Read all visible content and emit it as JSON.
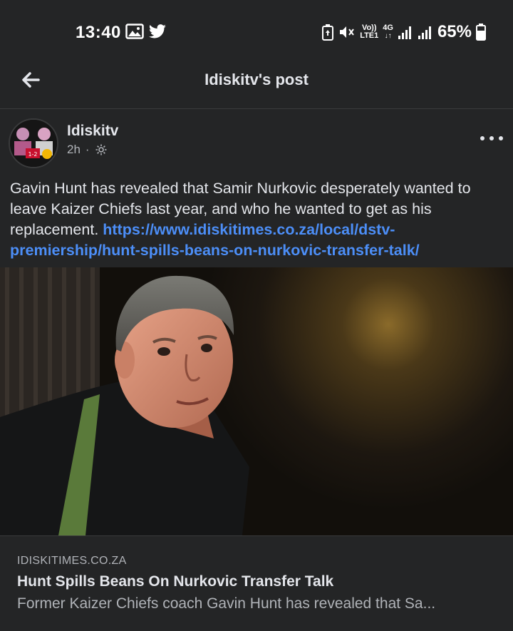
{
  "status_bar": {
    "time": "13:40",
    "left_icons": [
      "gallery-icon",
      "twitter-icon"
    ],
    "volte": "Vo))",
    "lte": "LTE1",
    "network": "4G",
    "battery": "65%"
  },
  "header": {
    "title": "Idiskitv's post",
    "back_icon": "back-arrow-icon"
  },
  "post": {
    "author": "Idiskitv",
    "time": "2h",
    "separator": "·",
    "privacy_icon": "public-gear-icon",
    "more_icon": "more-dots-icon",
    "text": "Gavin Hunt has revealed that Samir Nurkovic desperately wanted to leave Kaizer Chiefs last year, and who he wanted to get as his replacement. ",
    "link": "https://www.idiskitimes.co.za/local/dstv-premiership/hunt-spills-beans-on-nurkovic-transfer-talk/",
    "avatar_text": "1-2"
  },
  "link_card": {
    "domain": "IDISKITIMES.CO.ZA",
    "title": "Hunt Spills Beans On Nurkovic Transfer Talk",
    "description": "Former Kaizer Chiefs coach Gavin Hunt has revealed that Sa..."
  },
  "colors": {
    "background": "#242526",
    "text": "#e4e6eb",
    "secondary_text": "#b0b3b8",
    "link": "#4c8ef7",
    "divider": "#3a3b3c"
  }
}
